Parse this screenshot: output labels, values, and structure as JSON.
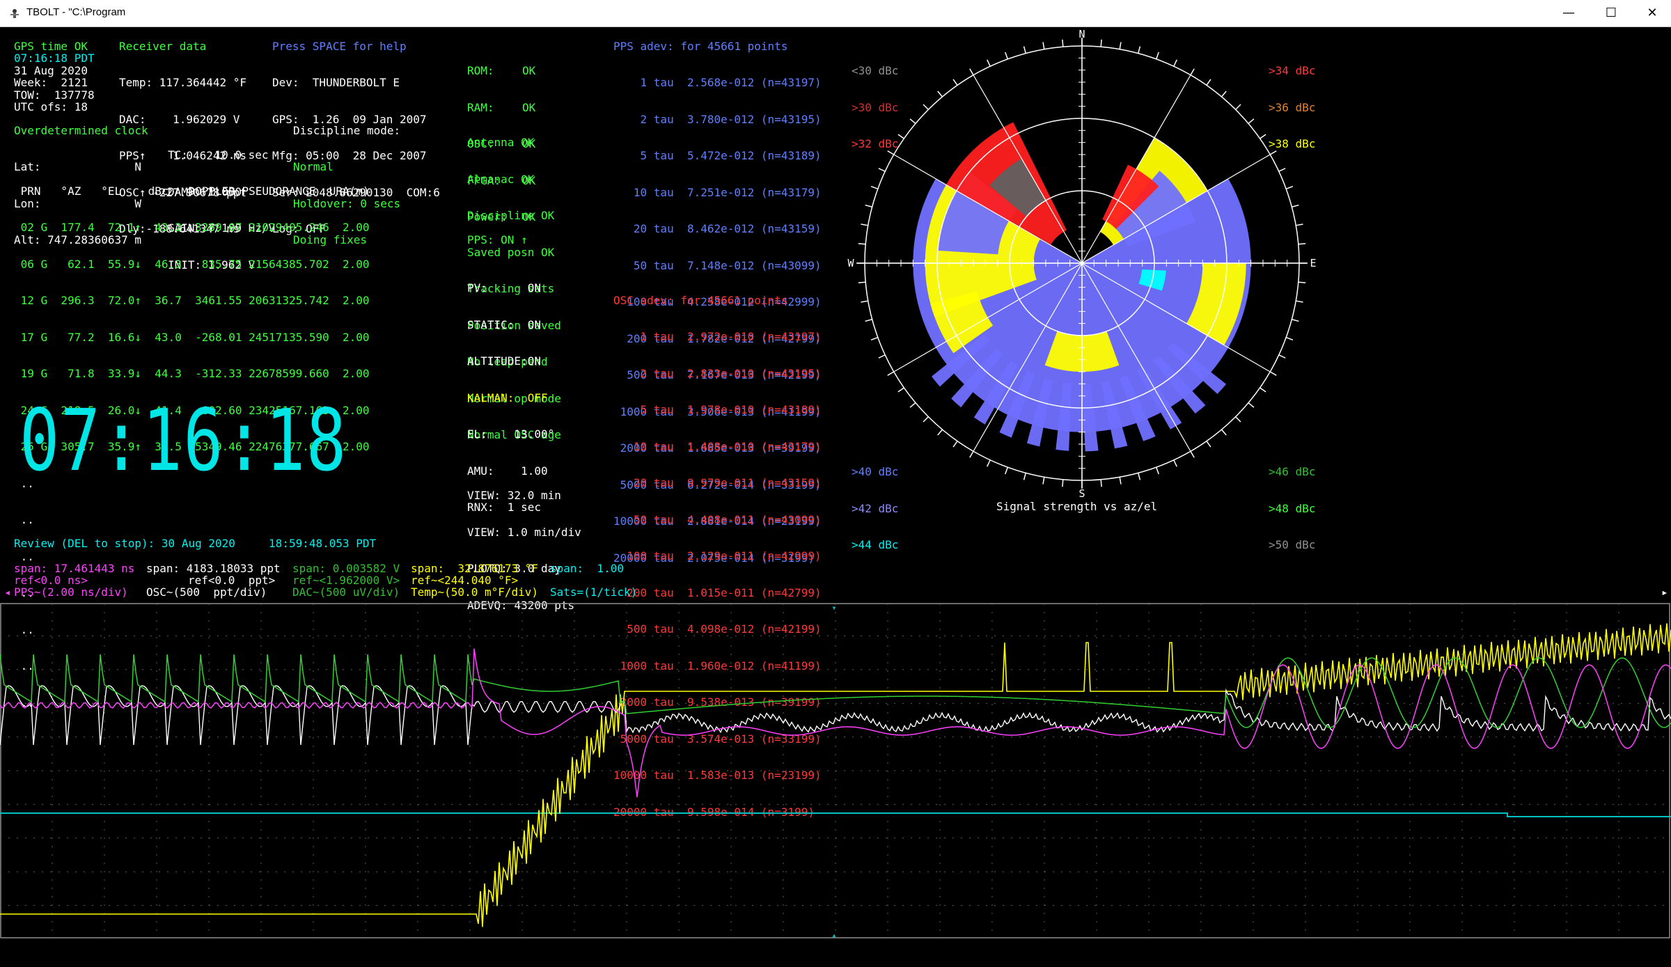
{
  "window": {
    "title": "TBOLT - \"C:\\Program",
    "minimize": "—",
    "maximize": "☐",
    "close": "✕"
  },
  "status": {
    "gps_time_label": "GPS time OK",
    "gps_time": "07:16:18 PDT",
    "date": "31 Aug 2020",
    "week": "Week:  2121",
    "tow": "TOW:  137778",
    "utc_ofs": "UTC ofs: 18"
  },
  "receiver": {
    "title": "Receiver data",
    "lines": [
      "Temp: 117.364442 °F",
      "DAC:    1.962029 V",
      "PPS↑    1.046242 ns",
      "OSC↑ -227.90678 ppt",
      "Dly:-188.641347 ns"
    ]
  },
  "device": {
    "help": "Press SPACE for help",
    "lines": [
      "Dev:  THUNDERBOLT E",
      "GPS:  1.26  09 Jan 2007",
      "Mfg: 05:00  28 Dec 2007",
      "Ser: 2048.86290130  COM:6",
      "Log: OFF"
    ]
  },
  "health": {
    "labels": [
      "ROM:",
      "RAM:",
      "OSC:",
      "FPGA:",
      "Power:"
    ],
    "values": [
      "OK",
      "OK",
      "OK",
      "OK",
      "OK"
    ],
    "flags": [
      "Antenna OK",
      "Almanac OK",
      "Discipline OK",
      "Saved posn OK",
      "Tracking sats",
      "Position saved",
      "No leap pend",
      "Normal op mode",
      "Normal OSC age"
    ],
    "pps": "PPS: ON ↑",
    "modes": [
      "PV:      ON",
      "STATIC:  ON",
      "ALTITUDE:ON"
    ],
    "kalman": "KALMAN:  OFF",
    "filters": [
      "EL:    13.00°",
      "AMU:    1.00",
      "RNX:  1 sec"
    ],
    "view": [
      "VIEW: 32.0 min",
      "VIEW: 1.0 min/div",
      "PLOTQ: 3.0 day",
      "ADEVQ: 43200 pts"
    ]
  },
  "clock": {
    "title": "Overdetermined clock",
    "lat": "Lat:              N",
    "lon": "Lon:              W",
    "alt": "Alt: 747.28360637 m",
    "params": [
      "TC:    10.0 sec",
      "DAMP: 1.000",
      "GAIN: 7.199 Hz/V",
      "INIT: 1.962 V"
    ],
    "discipline_title": "Discipline mode:",
    "discipline": [
      "Normal",
      "Holdover: 0 secs",
      "Doing fixes"
    ]
  },
  "sat_table": {
    "header": " PRN   °AZ   °EL    dBc   DOPPLER PSEUDORANGE  URA(m)",
    "rows": [
      " 02 G  177.4  72.1↑  43.2  3269.07 21029405.246  2.00",
      " 06 G   62.1  55.9↓  46.3   835.75 21564385.702  2.00",
      " 12 G  296.3  72.0↑  36.7  3461.55 20631325.742  2.00",
      " 17 G   77.2  16.6↓  43.0  -268.01 24517135.590  2.00",
      " 19 G   71.8  33.9↓  44.3  -312.33 22678599.660  2.00",
      " 24 G  218.5  26.0↓  41.4  -602.60 23425167.163  2.00",
      " 25 G  305.7  35.9↑  35.5  5349.46 22476377.667  2.00"
    ],
    "empty_rows": [
      " ..",
      " ..",
      " ..",
      " ..",
      " ..",
      " ..",
      " .."
    ]
  },
  "big_clock": "07:16:18",
  "pps_adev": {
    "title": "PPS adev: for 45661 points",
    "rows": [
      "    1 tau  2.568e-012 (n=43197)",
      "    2 tau  3.780e-012 (n=43195)",
      "    5 tau  5.472e-012 (n=43189)",
      "   10 tau  7.251e-012 (n=43179)",
      "   20 tau  8.462e-012 (n=43159)",
      "   50 tau  7.148e-012 (n=43099)",
      "  100 tau  4.258e-012 (n=42999)",
      "  200 tau  1.782e-012 (n=42799)",
      "  500 tau  7.167e-013 (n=42199)",
      " 1000 tau  3.506e-013 (n=41199)",
      " 2000 tau  1.685e-013 (n=39199)",
      " 5000 tau  6.272e-014 (n=33199)",
      "10000 tau  2.881e-014 (n=23199)",
      "20000 tau  2.075e-014 (n=3199)"
    ]
  },
  "osc_adev": {
    "title": "OSC adev: for 45661 points",
    "rows": [
      "    1 tau  2.972e-010 (n=43197)",
      "    2 tau  2.833e-010 (n=43195)",
      "    5 tau  1.978e-010 (n=43189)",
      "   10 tau  1.408e-010 (n=43179)",
      "   20 tau  9.979e-011 (n=43159)",
      "   50 tau  4.408e-011 (n=43099)",
      "  100 tau  2.129e-011 (n=42999)",
      "  200 tau  1.015e-011 (n=42799)",
      "  500 tau  4.098e-012 (n=42199)",
      " 1000 tau  1.960e-012 (n=41199)",
      " 2000 tau  9.538e-013 (n=39199)",
      " 5000 tau  3.574e-013 (n=33199)",
      "10000 tau  1.583e-013 (n=23199)",
      "20000 tau  9.598e-014 (n=3199)"
    ]
  },
  "sky_plot": {
    "caption": "Signal strength vs az/el",
    "compass": {
      "n": "N",
      "s": "S",
      "e": "E",
      "w": "W"
    },
    "legend_tl": [
      "<30 dBc",
      ">30 dBc",
      ">32 dBc"
    ],
    "legend_tr": [
      ">34 dBc",
      ">36 dBc",
      ">38 dBc"
    ],
    "legend_bl": [
      ">40 dBc",
      ">42 dBc",
      ">44 dBc"
    ],
    "legend_br": [
      ">46 dBc",
      ">48 dBc",
      ">50 dBc"
    ],
    "colors": {
      "grey": "#606060",
      "red": "#ff2020",
      "yellow": "#ffff00",
      "blue": "#7070ff",
      "cyan": "#00ffff"
    }
  },
  "review": "Review (DEL to stop): 30 Aug 2020     18:59:48.053 PDT",
  "plot_header": {
    "span_pps": "span: 17.461443 ns",
    "span_osc": "span: 4183.18033 ppt",
    "span_dac": "span: 0.003582 V",
    "span_temp": "span:  32.876173 °F",
    "span_sats": "span:  1.00",
    "ref_pps": "ref<0.0 ns>",
    "ref_osc": "ref<0.0  ppt>",
    "ref_dac": "ref~<1.962000 V>",
    "ref_temp": "ref~<244.040 °F>",
    "legend_pps": "PPS~(2.00 ns/div)",
    "legend_osc": "OSC~(500  ppt/div)",
    "legend_dac": "DAC~(500 uV/div)",
    "legend_temp": "Temp~(50.0 m°F/div)",
    "legend_sats": "Sats=(1/tick)"
  },
  "chart_data": {
    "type": "line",
    "xlabel": "",
    "ylabel": "",
    "x_divisions": 32,
    "y_divisions": 10,
    "grid": true,
    "series": [
      {
        "name": "PPS",
        "color": "#ff40ff"
      },
      {
        "name": "OSC",
        "color": "#ffffff"
      },
      {
        "name": "DAC",
        "color": "#30d030"
      },
      {
        "name": "Temp",
        "color": "#ffff00"
      },
      {
        "name": "Sats",
        "color": "#00c0c0"
      }
    ]
  }
}
